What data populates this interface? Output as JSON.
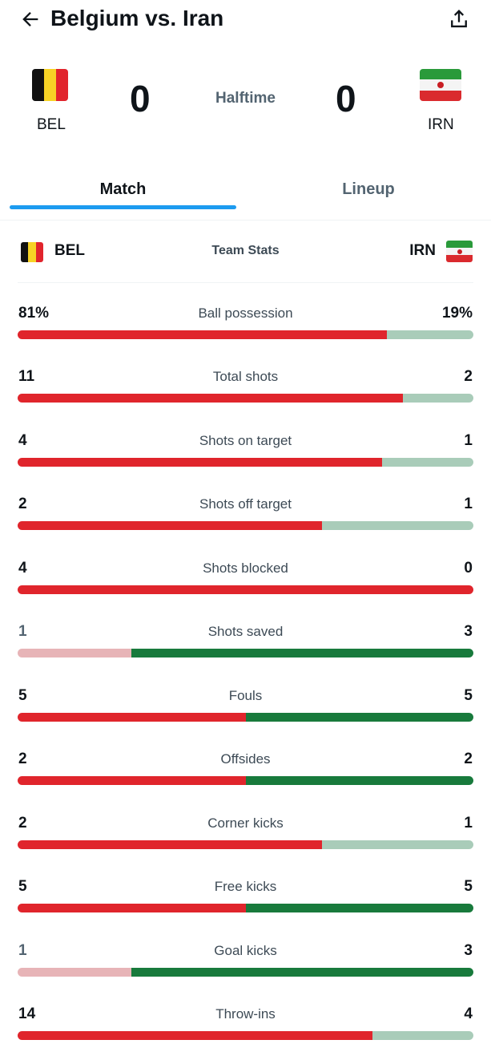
{
  "header": {
    "title": "Belgium vs. Iran",
    "back_icon": "arrow-left-icon",
    "share_icon": "share-upload-icon"
  },
  "match": {
    "home": {
      "code": "BEL",
      "score": "0",
      "flag_icon": "belgium-flag-icon"
    },
    "away": {
      "code": "IRN",
      "score": "0",
      "flag_icon": "iran-flag-icon"
    },
    "status": "Halftime"
  },
  "tabs": [
    {
      "label": "Match",
      "selected": true
    },
    {
      "label": "Lineup",
      "selected": false
    }
  ],
  "team_stats": {
    "title": "Team Stats",
    "home_code": "BEL",
    "away_code": "IRN",
    "colors": {
      "home_strong": "#e0252c",
      "home_weak": "#e7b4b7",
      "away_strong": "#187a3c",
      "away_weak": "#a9ccb9"
    },
    "rows": [
      {
        "label": "Ball possession",
        "home": "81%",
        "away": "19%",
        "home_share": 0.81,
        "leader": "home"
      },
      {
        "label": "Total shots",
        "home": "11",
        "away": "2",
        "home_share": 0.846,
        "leader": "home"
      },
      {
        "label": "Shots on target",
        "home": "4",
        "away": "1",
        "home_share": 0.8,
        "leader": "home"
      },
      {
        "label": "Shots off target",
        "home": "2",
        "away": "1",
        "home_share": 0.667,
        "leader": "home"
      },
      {
        "label": "Shots blocked",
        "home": "4",
        "away": "0",
        "home_share": 1.0,
        "leader": "home"
      },
      {
        "label": "Shots saved",
        "home": "1",
        "away": "3",
        "home_share": 0.25,
        "leader": "away"
      },
      {
        "label": "Fouls",
        "home": "5",
        "away": "5",
        "home_share": 0.5,
        "leader": "tie"
      },
      {
        "label": "Offsides",
        "home": "2",
        "away": "2",
        "home_share": 0.5,
        "leader": "tie"
      },
      {
        "label": "Corner kicks",
        "home": "2",
        "away": "1",
        "home_share": 0.667,
        "leader": "home"
      },
      {
        "label": "Free kicks",
        "home": "5",
        "away": "5",
        "home_share": 0.5,
        "leader": "tie"
      },
      {
        "label": "Goal kicks",
        "home": "1",
        "away": "3",
        "home_share": 0.25,
        "leader": "away"
      },
      {
        "label": "Throw-ins",
        "home": "14",
        "away": "4",
        "home_share": 0.778,
        "leader": "home"
      }
    ]
  }
}
